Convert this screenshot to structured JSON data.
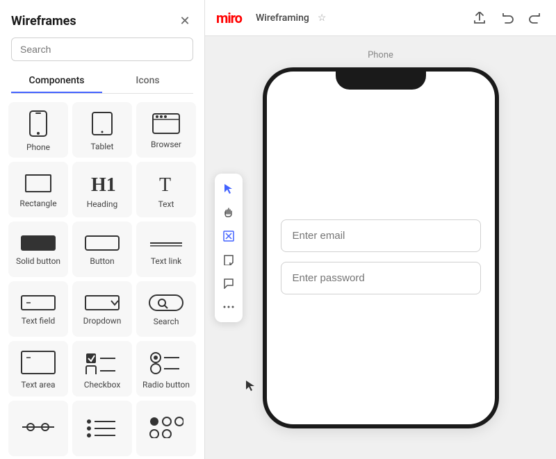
{
  "sidebar": {
    "title": "Wireframes",
    "search_placeholder": "Search",
    "tabs": [
      {
        "id": "components",
        "label": "Components",
        "active": true
      },
      {
        "id": "icons",
        "label": "Icons",
        "active": false
      }
    ],
    "components": [
      {
        "id": "phone",
        "label": "Phone"
      },
      {
        "id": "tablet",
        "label": "Tablet"
      },
      {
        "id": "browser",
        "label": "Browser"
      },
      {
        "id": "rectangle",
        "label": "Rectangle"
      },
      {
        "id": "heading",
        "label": "Heading"
      },
      {
        "id": "text",
        "label": "Text"
      },
      {
        "id": "solid-button",
        "label": "Solid button"
      },
      {
        "id": "button",
        "label": "Button"
      },
      {
        "id": "text-link",
        "label": "Text link"
      },
      {
        "id": "text-field",
        "label": "Text field"
      },
      {
        "id": "dropdown",
        "label": "Dropdown"
      },
      {
        "id": "search",
        "label": "Search"
      },
      {
        "id": "text-area",
        "label": "Text area"
      },
      {
        "id": "checkbox",
        "label": "Checkbox"
      },
      {
        "id": "radio-button",
        "label": "Radio button"
      },
      {
        "id": "slider",
        "label": ""
      },
      {
        "id": "list",
        "label": ""
      },
      {
        "id": "radio-group",
        "label": ""
      }
    ]
  },
  "topbar": {
    "logo": "miro",
    "workspace": "Wireframing",
    "undo_label": "↩",
    "redo_label": "↪",
    "upload_label": "⬆"
  },
  "canvas": {
    "phone_label": "Phone",
    "input1_placeholder": "Enter email",
    "input2_placeholder": "Enter password"
  },
  "toolbar": {
    "items": [
      {
        "id": "cursor",
        "symbol": "↖",
        "active": true
      },
      {
        "id": "hand",
        "symbol": "✋",
        "active": false
      },
      {
        "id": "frame",
        "symbol": "⊠",
        "active": false
      },
      {
        "id": "sticky",
        "symbol": "⬜",
        "active": false
      },
      {
        "id": "comment",
        "symbol": "💬",
        "active": false
      },
      {
        "id": "more",
        "symbol": "•••",
        "active": false
      }
    ]
  }
}
